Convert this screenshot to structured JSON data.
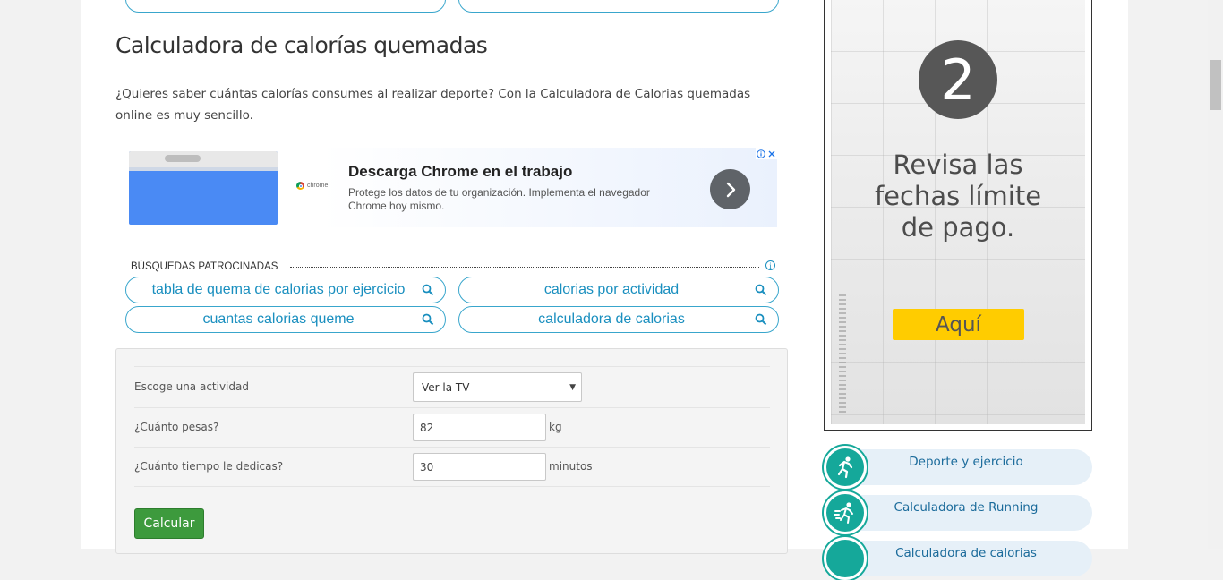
{
  "heading": "Calculadora de calorías quemadas",
  "intro": "¿Quieres saber cuántas calorías consumes al realizar deporte? Con la Calculadora de Calorias quemadas online es muy sencillo.",
  "ad_banner": {
    "brand": "chrome",
    "title": "Descarga Chrome en el trabajo",
    "description": "Protege los datos de tu organización. Implementa el navegador Chrome hoy mismo.",
    "go_icon": "chevron-right-icon",
    "info_icon": "info-icon",
    "close_icon": "close-icon"
  },
  "sponsored": {
    "label": "BÚSQUEDAS PATROCINADAS",
    "info_icon": "info-icon",
    "links": [
      "tabla de quema de calorias por ejercicio",
      "calorias por actividad",
      "cuantas calorias queme",
      "calculadora de calorias"
    ]
  },
  "form": {
    "activity_label": "Escoge una actividad",
    "activity_value": "Ver la TV",
    "weight_label": "¿Cuánto pesas?",
    "weight_value": "82",
    "weight_unit": "kg",
    "time_label": "¿Cuánto tiempo le dedicas?",
    "time_value": "30",
    "time_unit": "minutos",
    "submit_label": "Calcular"
  },
  "side_ad": {
    "number": "2",
    "text_line1": "Revisa las",
    "text_line2": "fechas límite",
    "text_line3": "de pago.",
    "button_label": "Aquí"
  },
  "sidebar": {
    "items": [
      {
        "label": "Deporte y ejercicio",
        "icon": "running-icon"
      },
      {
        "label": "Calculadora de Running",
        "icon": "sprint-icon"
      },
      {
        "label": "Calculadora de calorias",
        "icon": "calculator-icon"
      }
    ]
  },
  "colors": {
    "link": "#1a8fbf",
    "button_green": "#3d9a3d",
    "side_teal": "#15a89a",
    "ad_yellow": "#ffcc00"
  }
}
